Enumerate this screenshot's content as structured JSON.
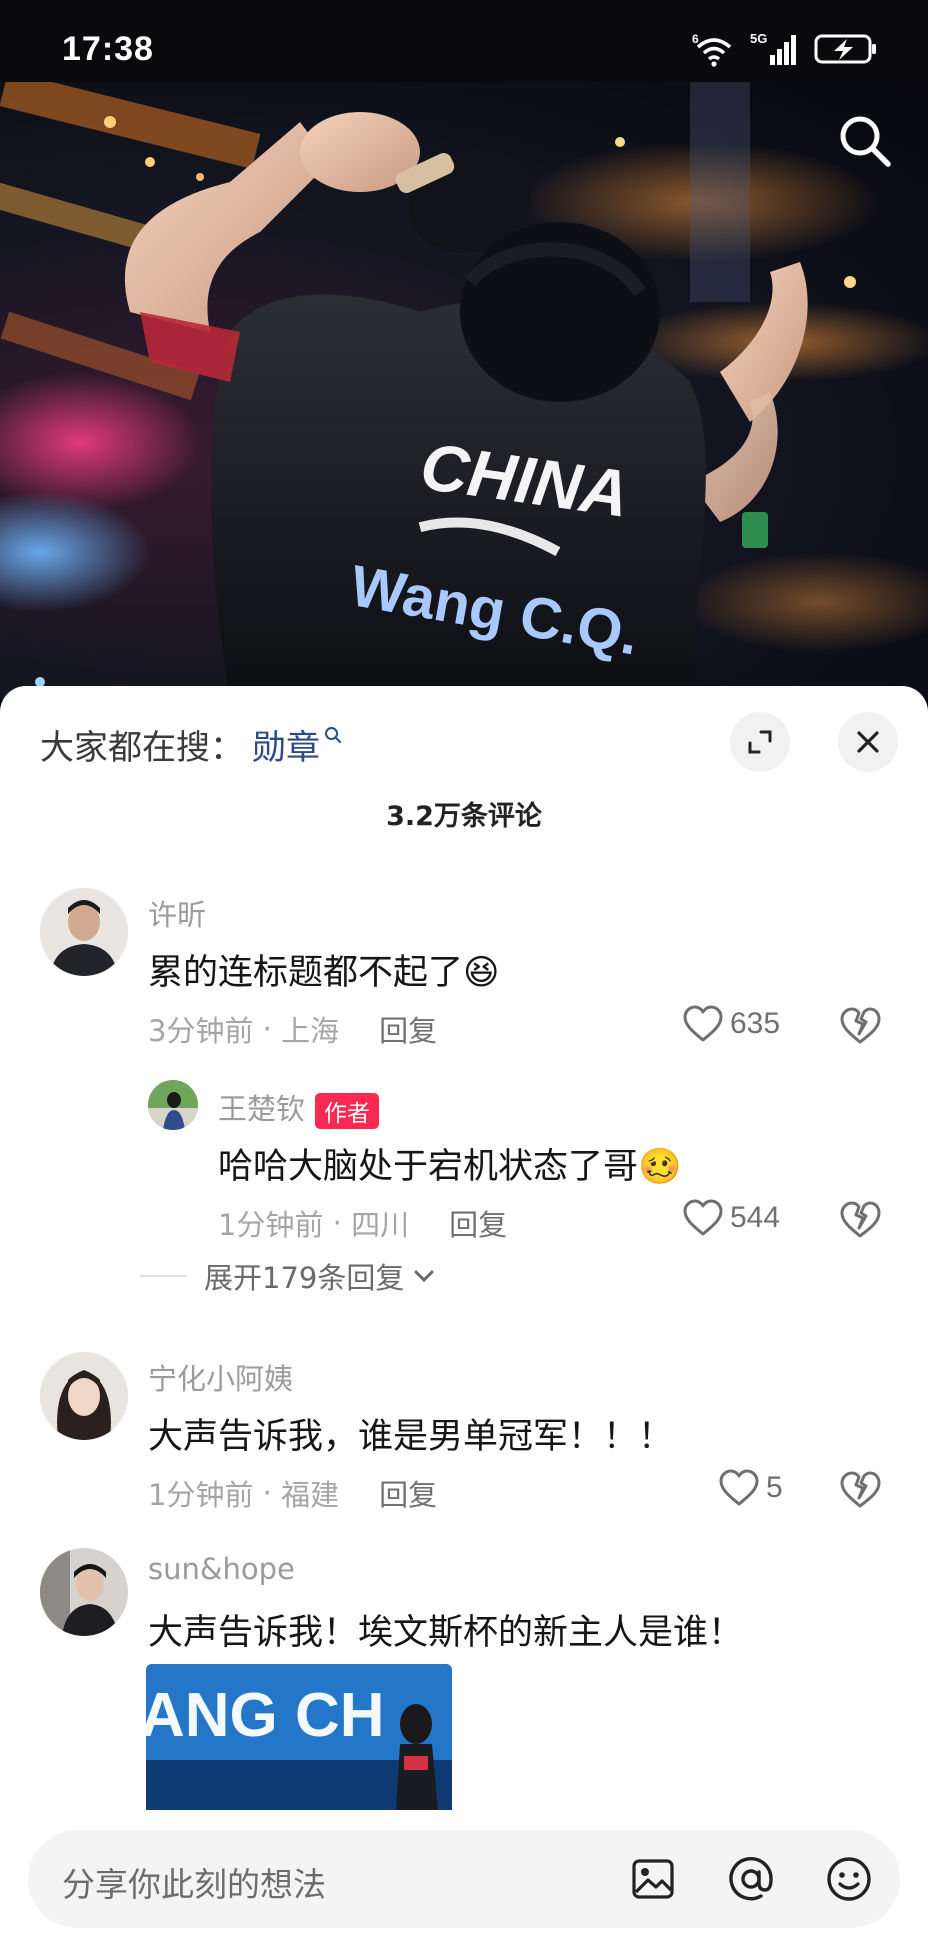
{
  "status_bar": {
    "time": "17:38",
    "wifi_label": "6",
    "network": "5G"
  },
  "hero": {
    "jersey_country": "CHINA",
    "jersey_name": "Wang C.Q."
  },
  "trending": {
    "prefix": "大家都在搜：",
    "keyword": "勋章"
  },
  "comment_count": "3.2万条评论",
  "comments": [
    {
      "name": "许昕",
      "text": "累的连标题都不起了😆",
      "time": "3分钟前",
      "location": "上海",
      "reply_label": "回复",
      "likes": "635"
    },
    {
      "name": "王楚钦",
      "badge": "作者",
      "text": "哈哈大脑处于宕机状态了哥🥴",
      "time": "1分钟前",
      "location": "四川",
      "reply_label": "回复",
      "likes": "544"
    },
    {
      "name": "宁化小阿姨",
      "text": "大声告诉我，谁是男单冠军！！！",
      "time": "1分钟前",
      "location": "福建",
      "reply_label": "回复",
      "likes": "5"
    },
    {
      "name": "sun&hope",
      "text": "大声告诉我！埃文斯杯的新主人是谁！",
      "image_text": "ANG CH"
    }
  ],
  "expand_replies": "展开179条回复",
  "input": {
    "placeholder": "分享你此刻的想法"
  },
  "colors": {
    "accent_link": "#2b4a86",
    "author_badge": "#fb2851",
    "sheet_bg": "#ffffff"
  },
  "icons": [
    "search-icon",
    "expand-icon",
    "close-icon",
    "heart-icon",
    "dislike-icon",
    "image-icon",
    "at-icon",
    "emoji-icon"
  ]
}
